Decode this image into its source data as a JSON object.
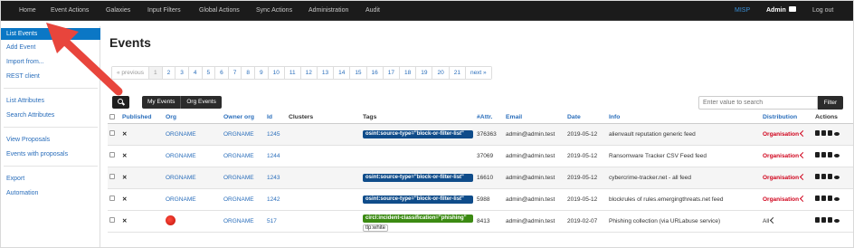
{
  "topnav": {
    "items": [
      "Home",
      "Event Actions",
      "Galaxies",
      "Input Filters",
      "Global Actions",
      "Sync Actions",
      "Administration",
      "Audit"
    ],
    "brand": "MISP",
    "user": "Admin",
    "logout": "Log out"
  },
  "sidebar": {
    "items": [
      "List Events",
      "Add Event",
      "Import from...",
      "REST client",
      "List Attributes",
      "Search Attributes",
      "View Proposals",
      "Events with proposals",
      "Export",
      "Automation"
    ],
    "active": "List Events"
  },
  "page_title": "Events",
  "pagination": {
    "prev": "« previous",
    "pages": [
      "1",
      "2",
      "3",
      "4",
      "5",
      "6",
      "7",
      "8",
      "9",
      "10",
      "11",
      "12",
      "13",
      "14",
      "15",
      "16",
      "17",
      "18",
      "19",
      "20",
      "21"
    ],
    "current": "1",
    "next": "next »"
  },
  "filters": {
    "my_events": "My Events",
    "org_events": "Org Events",
    "search_placeholder": "Enter value to search",
    "filter_button": "Filter"
  },
  "table": {
    "headers": {
      "published": "Published",
      "org": "Org",
      "owner_org": "Owner org",
      "id": "Id",
      "clusters": "Clusters",
      "tags": "Tags",
      "attr": "#Attr.",
      "email": "Email",
      "date": "Date",
      "info": "Info",
      "distribution": "Distribution",
      "actions": "Actions"
    },
    "rows": [
      {
        "published": "✕",
        "org": "ORGNAME",
        "owner_org": "ORGNAME",
        "id": "1245",
        "tag": "osint:source-type=\"block-or-filter-list\"",
        "tag_color": "#0f4c8a",
        "attr": "376363",
        "email": "admin@admin.test",
        "date": "2019-05-12",
        "info": "alienvault reputation generic feed",
        "distribution": "Organisation"
      },
      {
        "published": "✕",
        "org": "ORGNAME",
        "owner_org": "ORGNAME",
        "id": "1244",
        "tag": "",
        "attr": "37069",
        "email": "admin@admin.test",
        "date": "2019-05-12",
        "info": "Ransomware Tracker CSV Feed feed",
        "distribution": "Organisation"
      },
      {
        "published": "✕",
        "org": "ORGNAME",
        "owner_org": "ORGNAME",
        "id": "1243",
        "tag": "osint:source-type=\"block-or-filter-list\"",
        "tag_color": "#0f4c8a",
        "attr": "16610",
        "email": "admin@admin.test",
        "date": "2019-05-12",
        "info": "cybercrime-tracker.net - all feed",
        "distribution": "Organisation"
      },
      {
        "published": "✕",
        "org": "ORGNAME",
        "owner_org": "ORGNAME",
        "id": "1242",
        "tag": "osint:source-type=\"block-or-filter-list\"",
        "tag_color": "#0f4c8a",
        "attr": "5988",
        "email": "admin@admin.test",
        "date": "2019-05-12",
        "info": "blockrules of rules.emergingthreats.net feed",
        "distribution": "Organisation"
      },
      {
        "published": "✕",
        "org": "",
        "owner_org": "ORGNAME",
        "id": "517",
        "tag": "circl:incident-classification=\"phishing\"",
        "tag_color": "#3b8a12",
        "tag2": "tlp:white",
        "attr": "8413",
        "email": "admin@admin.test",
        "date": "2019-02-07",
        "info": "Phishing collection (via URLabuse service)",
        "distribution": "All"
      }
    ]
  },
  "colors": {
    "navbar": "#1b1b1b",
    "active_sidebar": "#0b77c5",
    "link": "#2a6ebb",
    "distribution_red": "#d0021b",
    "arrow": "#e8453c"
  }
}
